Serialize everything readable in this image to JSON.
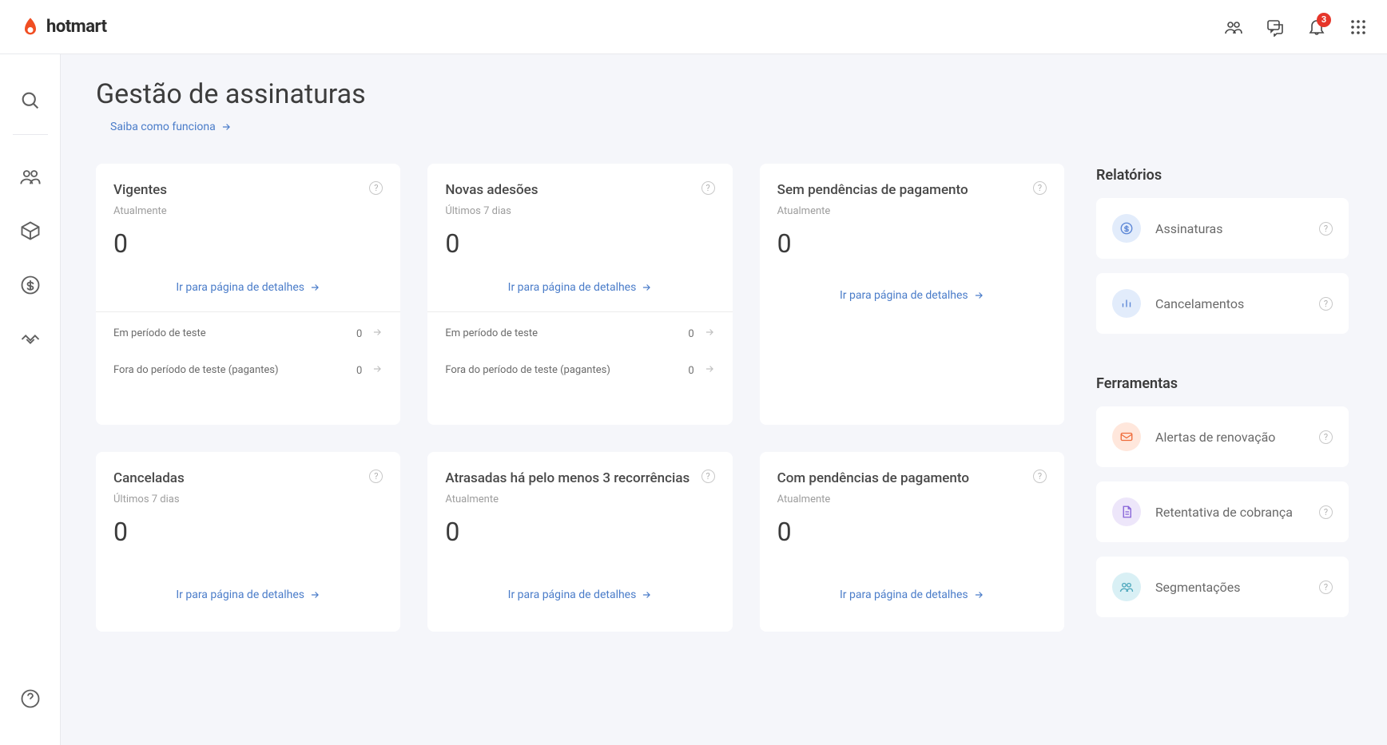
{
  "header": {
    "brand": "hotmart",
    "notif_count": "3"
  },
  "page": {
    "title": "Gestão de assinaturas",
    "learn_more": "Saiba como funciona"
  },
  "cards": [
    {
      "title": "Vigentes",
      "subtitle": "Atualmente",
      "value": "0",
      "link": "Ir para página de detalhes",
      "subs": [
        {
          "label": "Em período de teste",
          "value": "0"
        },
        {
          "label": "Fora do período de teste (pagantes)",
          "value": "0"
        }
      ]
    },
    {
      "title": "Novas adesões",
      "subtitle": "Últimos 7 dias",
      "value": "0",
      "link": "Ir para página de detalhes",
      "subs": [
        {
          "label": "Em período de teste",
          "value": "0"
        },
        {
          "label": "Fora do período de teste (pagantes)",
          "value": "0"
        }
      ]
    },
    {
      "title": "Sem pendências de pagamento",
      "subtitle": "Atualmente",
      "value": "0",
      "link": "Ir para página de detalhes",
      "subs": []
    },
    {
      "title": "Canceladas",
      "subtitle": "Últimos 7 dias",
      "value": "0",
      "link": "Ir para página de detalhes",
      "subs": []
    },
    {
      "title": "Atrasadas há pelo menos 3 recorrências",
      "subtitle": "Atualmente",
      "value": "0",
      "link": "Ir para página de detalhes",
      "subs": []
    },
    {
      "title": "Com pendências de pagamento",
      "subtitle": "Atualmente",
      "value": "0",
      "link": "Ir para página de detalhes",
      "subs": []
    }
  ],
  "reports": {
    "heading": "Relatórios",
    "items": [
      {
        "label": "Assinaturas",
        "icon": "dollar"
      },
      {
        "label": "Cancelamentos",
        "icon": "bars"
      }
    ]
  },
  "tools": {
    "heading": "Ferramentas",
    "items": [
      {
        "label": "Alertas de renovação",
        "icon": "mail"
      },
      {
        "label": "Retentativa de cobrança",
        "icon": "doc"
      },
      {
        "label": "Segmentações",
        "icon": "people"
      }
    ]
  }
}
